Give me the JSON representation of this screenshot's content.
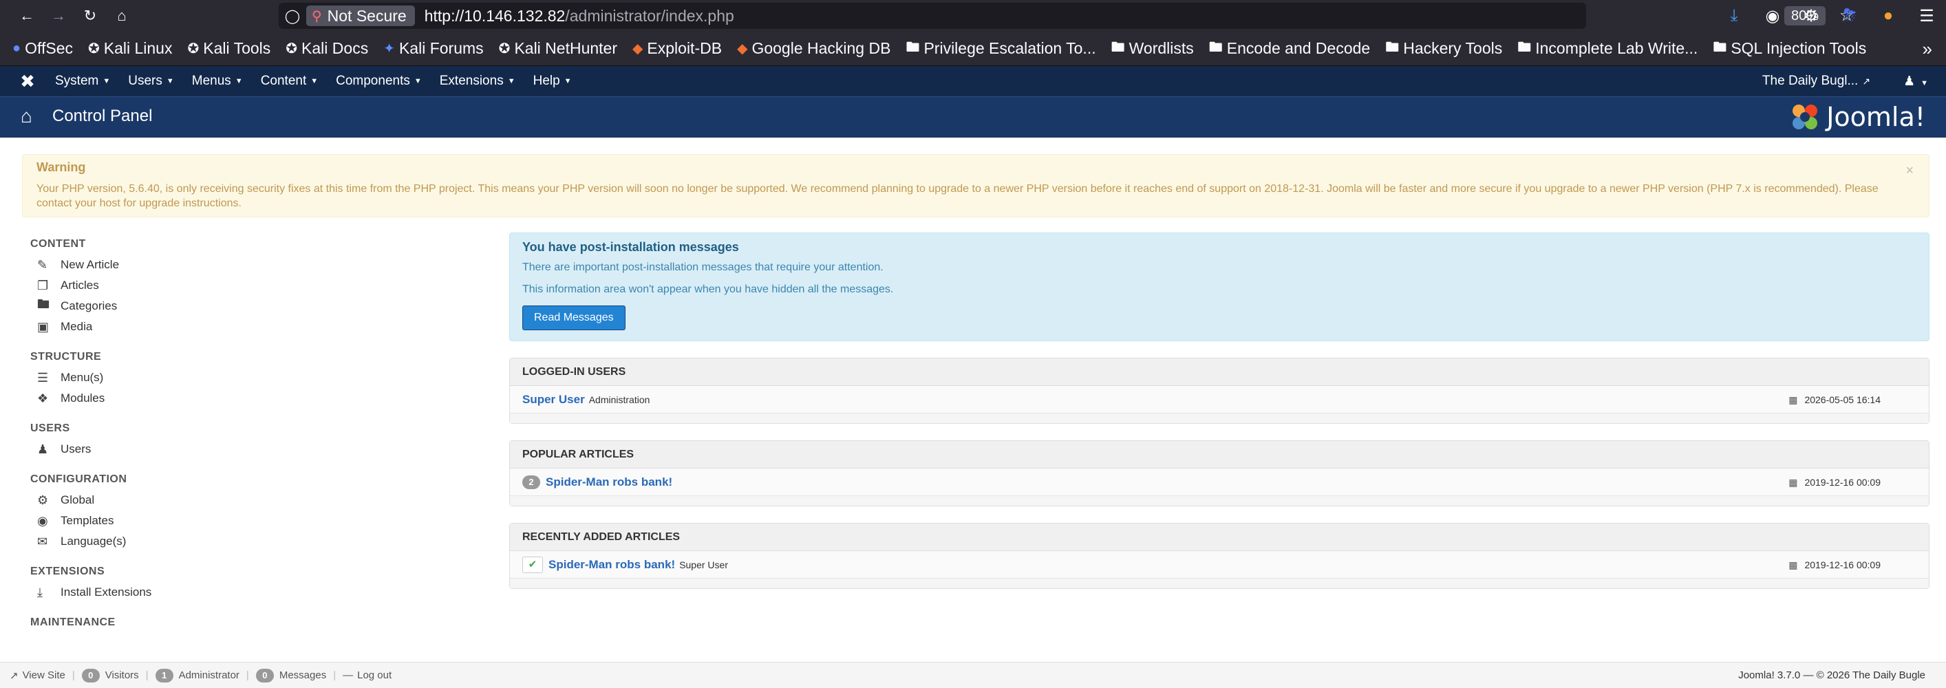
{
  "browser": {
    "not_secure": "Not Secure",
    "url_host": "http://10.146.132.82",
    "url_path": "/administrator/index.php",
    "zoom": "80%",
    "bookmarks": [
      "OffSec",
      "Kali Linux",
      "Kali Tools",
      "Kali Docs",
      "Kali Forums",
      "Kali NetHunter",
      "Exploit-DB",
      "Google Hacking DB",
      "Privilege Escalation To...",
      "Wordlists",
      "Encode and Decode",
      "Hackery Tools",
      "Incomplete Lab Write...",
      "SQL Injection Tools"
    ]
  },
  "nav": {
    "menus": [
      "System",
      "Users",
      "Menus",
      "Content",
      "Components",
      "Extensions",
      "Help"
    ],
    "site_name": "The Daily Bugl..."
  },
  "header": {
    "title": "Control Panel",
    "brand": "Joomla!"
  },
  "warning": {
    "title": "Warning",
    "text": "Your PHP version, 5.6.40, is only receiving security fixes at this time from the PHP project. This means your PHP version will soon no longer be supported. We recommend planning to upgrade to a newer PHP version before it reaches end of support on 2018-12-31. Joomla will be faster and more secure if you upgrade to a newer PHP version (PHP 7.x is recommended). Please contact your host for upgrade instructions."
  },
  "sidebar": {
    "content": {
      "title": "CONTENT",
      "items": [
        "New Article",
        "Articles",
        "Categories",
        "Media"
      ]
    },
    "structure": {
      "title": "STRUCTURE",
      "items": [
        "Menu(s)",
        "Modules"
      ]
    },
    "users": {
      "title": "USERS",
      "items": [
        "Users"
      ]
    },
    "configuration": {
      "title": "CONFIGURATION",
      "items": [
        "Global",
        "Templates",
        "Language(s)"
      ]
    },
    "extensions": {
      "title": "EXTENSIONS",
      "items": [
        "Install Extensions"
      ]
    },
    "maintenance": {
      "title": "MAINTENANCE"
    }
  },
  "post_install": {
    "title": "You have post-installation messages",
    "line1": "There are important post-installation messages that require your attention.",
    "line2": "This information area won't appear when you have hidden all the messages.",
    "button": "Read Messages"
  },
  "logged_in": {
    "title": "LOGGED-IN USERS",
    "user": "Super User",
    "role": "Administration",
    "date": "2026-05-05 16:14"
  },
  "popular": {
    "title": "POPULAR ARTICLES",
    "hits": "2",
    "article": "Spider-Man robs bank!",
    "date": "2019-12-16 00:09"
  },
  "recent": {
    "title": "RECENTLY ADDED ARTICLES",
    "article": "Spider-Man robs bank!",
    "author": "Super User",
    "date": "2019-12-16 00:09"
  },
  "status": {
    "view_site": "View Site",
    "visitors_count": "0",
    "visitors": "Visitors",
    "admin_count": "1",
    "admin": "Administrator",
    "messages_count": "0",
    "messages": "Messages",
    "logout": "Log out",
    "version": "Joomla! 3.7.0",
    "dash": "—",
    "copyright": "© 2026 The Daily Bugle"
  }
}
